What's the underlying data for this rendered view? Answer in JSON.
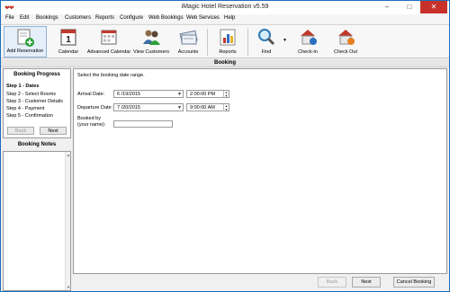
{
  "window": {
    "title": "iMagic Hotel Reservation v5.59",
    "min_glyph": "–",
    "max_glyph": "□",
    "close_glyph": "✕"
  },
  "menu": [
    "File",
    "Edit",
    "Bookings",
    "Customers",
    "Reports",
    "Configure",
    "Web Bookings",
    "Web Services",
    "Help"
  ],
  "toolbar": {
    "add_reservation": "Add Reservation",
    "calendar": "Calendar",
    "advanced_calendar": "Advanced Calendar",
    "view_customers": "View Customers",
    "accounts": "Accounts",
    "reports": "Reports",
    "find": "Find",
    "check_in": "Check-in",
    "check_out": "Check Out",
    "calendar_day": "1"
  },
  "header": {
    "title": "Booking"
  },
  "progress": {
    "title": "Booking Progress",
    "steps": [
      "Step 1 - Dates",
      "Step 2 - Select Rooms",
      "Step 3 - Customer Details",
      "Step 4 - Payment",
      "Step 5 - Confirmation"
    ],
    "back_label": "Back",
    "next_label": "Next"
  },
  "notes": {
    "title": "Booking Notes"
  },
  "form": {
    "intro": "Select the booking date range.",
    "arrival_label": "Arrival Date:",
    "arrival_date": "6 /19/2015",
    "arrival_time": "2:00:00 PM",
    "departure_label": "Departure Date:",
    "departure_date": "7 /20/2015",
    "departure_time": "9:00:00 AM",
    "booked_by_label_1": "Booked by",
    "booked_by_label_2": "(your name):",
    "booked_by_value": ""
  },
  "footer": {
    "back_label": "Back",
    "next_label": "Next",
    "cancel_label": "Cancel Booking"
  },
  "colors": {
    "window_border": "#1b6fc0",
    "close_button": "#c7312a",
    "accent_green": "#2e9e3a",
    "calendar_red": "#c0392b"
  }
}
